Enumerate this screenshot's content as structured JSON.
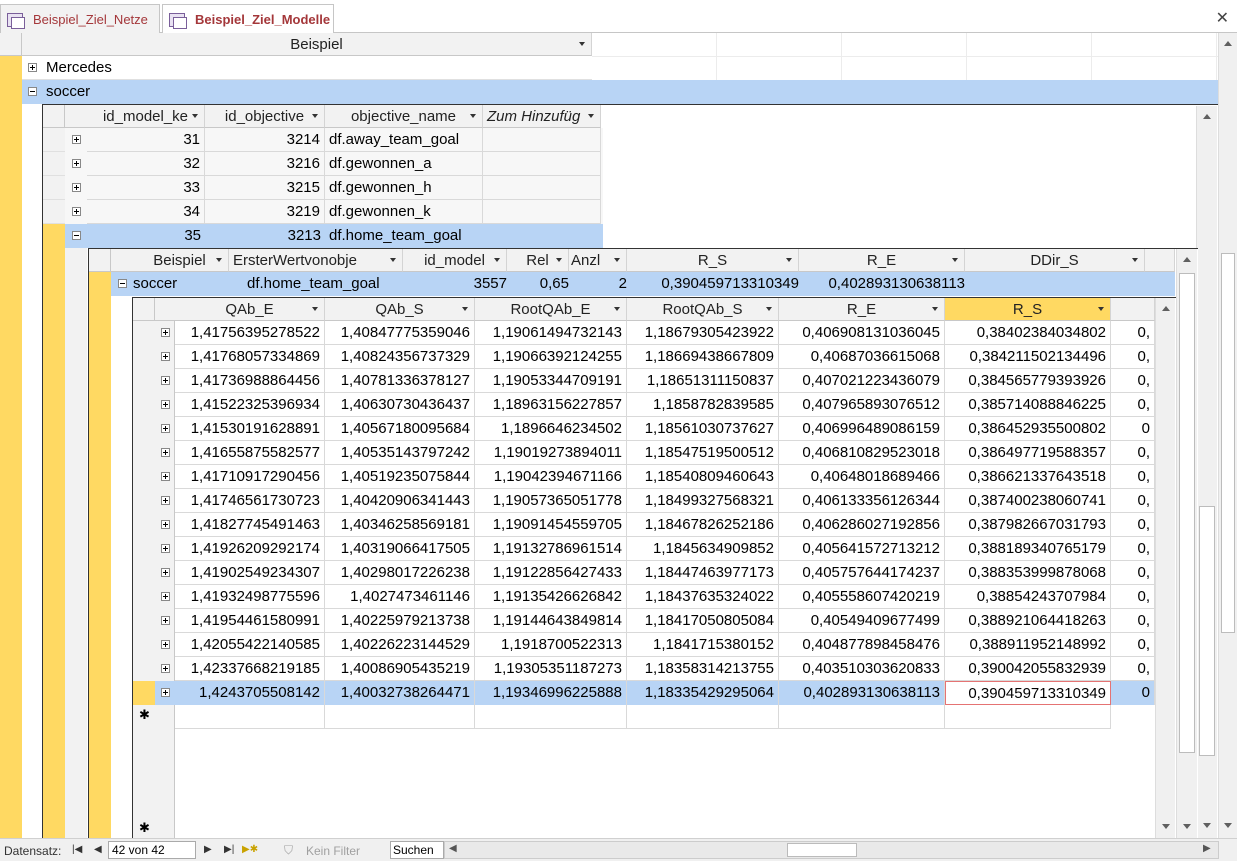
{
  "tabs": [
    {
      "label": "Beispiel_Ziel_Netze",
      "icon": "form-icon"
    },
    {
      "label": "Beispiel_Ziel_Modelle",
      "icon": "form-icon",
      "active": true
    }
  ],
  "close_label": "✕",
  "top": {
    "header": "Beispiel",
    "rows": [
      {
        "label": "Mercedes",
        "expanded": false
      },
      {
        "label": "soccer",
        "expanded": true
      }
    ]
  },
  "level2": {
    "headers": [
      "id_model_ke",
      "id_objective",
      "objective_name",
      "Zum Hinzufüg"
    ],
    "rows": [
      {
        "id_model_key": "31",
        "id_objective": "3214",
        "objective_name": "df.away_team_goal"
      },
      {
        "id_model_key": "32",
        "id_objective": "3216",
        "objective_name": "df.gewonnen_a"
      },
      {
        "id_model_key": "33",
        "id_objective": "3215",
        "objective_name": "df.gewonnen_h"
      },
      {
        "id_model_key": "34",
        "id_objective": "3219",
        "objective_name": "df.gewonnen_k"
      },
      {
        "id_model_key": "35",
        "id_objective": "3213",
        "objective_name": "df.home_team_goal",
        "expanded": true
      }
    ]
  },
  "level3": {
    "headers": [
      "Beispiel",
      "ErsterWertvonobje",
      "id_model",
      "Rel",
      "Anzl",
      "R_S",
      "R_E",
      "DDir_S"
    ],
    "row": {
      "beispiel": "soccer",
      "erster": "df.home_team_goal",
      "id_model": "3557",
      "rel": "0,65",
      "anz": "2",
      "r_s": "0,390459713310349",
      "r_e": "0,402893130638113"
    }
  },
  "level4": {
    "headers": [
      "QAb_E",
      "QAb_S",
      "RootQAb_E",
      "RootQAb_S",
      "R_E",
      "R_S"
    ],
    "rows": [
      [
        "1,41756395278522",
        "1,40847775359046",
        "1,19061494732143",
        "1,18679305423922",
        "0,406908131036045",
        "0,38402384034802",
        "0,"
      ],
      [
        "1,41768057334869",
        "1,40824356737329",
        "1,19066392124255",
        "1,18669438667809",
        "0,40687036615068",
        "0,384211502134496",
        "0,"
      ],
      [
        "1,41736988864456",
        "1,40781336378127",
        "1,19053344709191",
        "1,18651311150837",
        "0,407021223436079",
        "0,384565779393926",
        "0,"
      ],
      [
        "1,41522325396934",
        "1,40630730436437",
        "1,18963156227857",
        "1,1858782839585",
        "0,407965893076512",
        "0,385714088846225",
        "0,"
      ],
      [
        "1,41530191628891",
        "1,40567180095684",
        "1,1896646234502",
        "1,18561030737627",
        "0,406996489086159",
        "0,386452935500802",
        "0"
      ],
      [
        "1,41655875582577",
        "1,40535143797242",
        "1,19019273894011",
        "1,18547519500512",
        "0,406810829523018",
        "0,386497719588357",
        "0,"
      ],
      [
        "1,41710917290456",
        "1,40519235075844",
        "1,19042394671166",
        "1,18540809460643",
        "0,40648018689466",
        "0,386621337643518",
        "0,"
      ],
      [
        "1,41746561730723",
        "1,40420906341443",
        "1,19057365051778",
        "1,18499327568321",
        "0,406133356126344",
        "0,387400238060741",
        "0,"
      ],
      [
        "1,41827745491463",
        "1,40346258569181",
        "1,19091454559705",
        "1,18467826252186",
        "0,406286027192856",
        "0,387982667031793",
        "0,"
      ],
      [
        "1,41926209292174",
        "1,40319066417505",
        "1,19132786961514",
        "1,1845634909852",
        "0,405641572713212",
        "0,388189340765179",
        "0,"
      ],
      [
        "1,41902549234307",
        "1,40298017226238",
        "1,19122856427433",
        "1,18447463977173",
        "0,405757644174237",
        "0,388353999878068",
        "0,"
      ],
      [
        "1,41932498775596",
        "1,4027473461146",
        "1,19135426626842",
        "1,18437635324022",
        "0,405558607420219",
        "0,38854243707984",
        "0,"
      ],
      [
        "1,41954461580991",
        "1,40225979213738",
        "1,19144643849814",
        "1,18417050805084",
        "0,40549409677499",
        "0,388921064418263",
        "0,"
      ],
      [
        "1,42055422140585",
        "1,40226223144529",
        "1,1918700522313",
        "1,1841715380152",
        "0,404877898458476",
        "0,388911952148992",
        "0,"
      ],
      [
        "1,42337668219185",
        "1,40086905435219",
        "1,19305351187273",
        "1,18358314213755",
        "0,403510303620833",
        "0,390042055832939",
        "0,"
      ],
      [
        "1,4243705508142",
        "1,40032738264471",
        "1,19346996225888",
        "1,18335429295064",
        "0,402893130638113",
        "0,390459713310349",
        "0"
      ]
    ],
    "new_row_marker": "✱"
  },
  "status": {
    "record_label": "Datensatz:",
    "record_value": "42 von 42",
    "filter_label": "Kein Filter",
    "search_label": "Suchen"
  },
  "colors": {
    "accent": "#ffd962",
    "selection": "#b8d4f5",
    "tab_text": "#a4373a"
  }
}
